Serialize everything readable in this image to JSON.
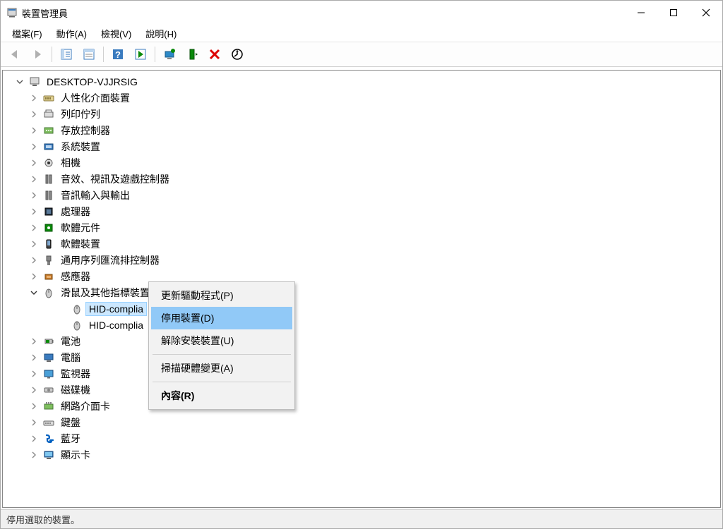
{
  "window": {
    "title": "裝置管理員"
  },
  "menu": {
    "file": "檔案(F)",
    "action": "動作(A)",
    "view": "檢視(V)",
    "help": "說明(H)"
  },
  "tree": {
    "root": "DESKTOP-VJJRSIG",
    "categories": [
      "人性化介面裝置",
      "列印佇列",
      "存放控制器",
      "系統裝置",
      "相機",
      "音效、視訊及遊戲控制器",
      "音訊輸入與輸出",
      "處理器",
      "軟體元件",
      "軟體裝置",
      "通用序列匯流排控制器",
      "感應器",
      "滑鼠及其他指標裝置",
      "電池",
      "電腦",
      "監視器",
      "磁碟機",
      "網路介面卡",
      "鍵盤",
      "藍牙",
      "顯示卡"
    ],
    "mouse_children": [
      "HID-complia",
      "HID-complia"
    ]
  },
  "context_menu": {
    "update": "更新驅動程式(P)",
    "disable": "停用裝置(D)",
    "uninstall": "解除安裝裝置(U)",
    "scan": "掃描硬體變更(A)",
    "properties": "內容(R)"
  },
  "statusbar": {
    "text": "停用選取的裝置。"
  }
}
